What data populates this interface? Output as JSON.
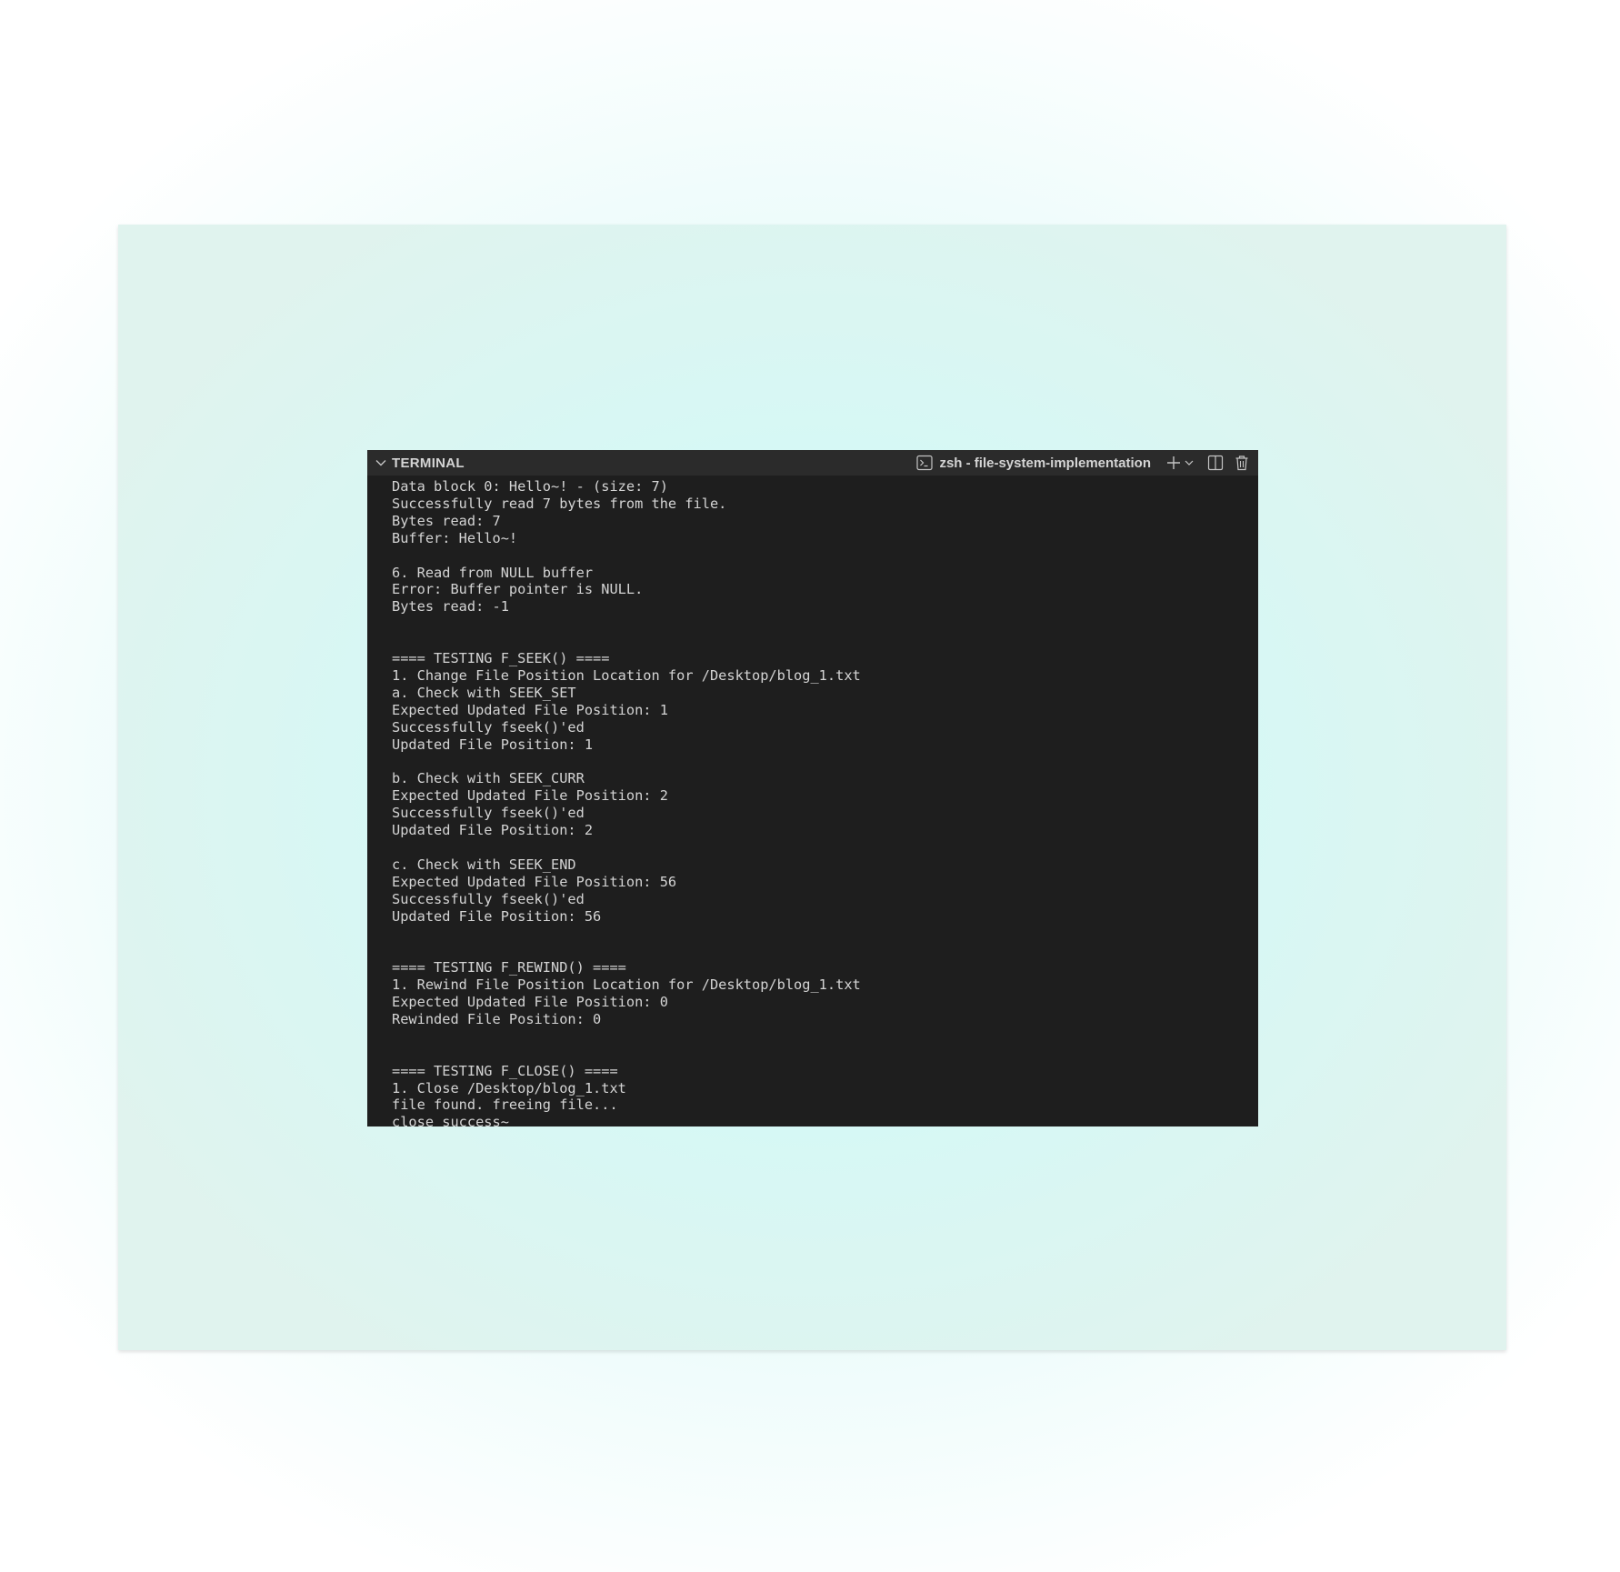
{
  "header": {
    "panel_title": "TERMINAL",
    "shell_name": "zsh - file-system-implementation",
    "icons": [
      "chevron-down-icon",
      "terminal-icon",
      "plus-icon",
      "chevron-down-icon",
      "split-icon",
      "trash-icon"
    ]
  },
  "colors": {
    "terminal_bg": "#1e1e1e",
    "header_bg": "#2b2b2b",
    "text": "#d4d4d4"
  },
  "terminal": {
    "lines": [
      "Data block 0: Hello~! - (size: 7)",
      "Successfully read 7 bytes from the file.",
      "Bytes read: 7",
      "Buffer: Hello~!",
      "",
      "6. Read from NULL buffer",
      "Error: Buffer pointer is NULL.",
      "Bytes read: -1",
      "",
      "",
      "==== TESTING F_SEEK() ====",
      "1. Change File Position Location for /Desktop/blog_1.txt",
      "a. Check with SEEK_SET",
      "Expected Updated File Position: 1",
      "Successfully fseek()'ed",
      "Updated File Position: 1",
      "",
      "b. Check with SEEK_CURR",
      "Expected Updated File Position: 2",
      "Successfully fseek()'ed",
      "Updated File Position: 2",
      "",
      "c. Check with SEEK_END",
      "Expected Updated File Position: 56",
      "Successfully fseek()'ed",
      "Updated File Position: 56",
      "",
      "",
      "==== TESTING F_REWIND() ====",
      "1. Rewind File Position Location for /Desktop/blog_1.txt",
      "Expected Updated File Position: 0",
      "Rewinded File Position: 0",
      "",
      "",
      "==== TESTING F_CLOSE() ====",
      "1. Close /Desktop/blog_1.txt",
      "file found. freeing file...",
      "close success~"
    ]
  }
}
